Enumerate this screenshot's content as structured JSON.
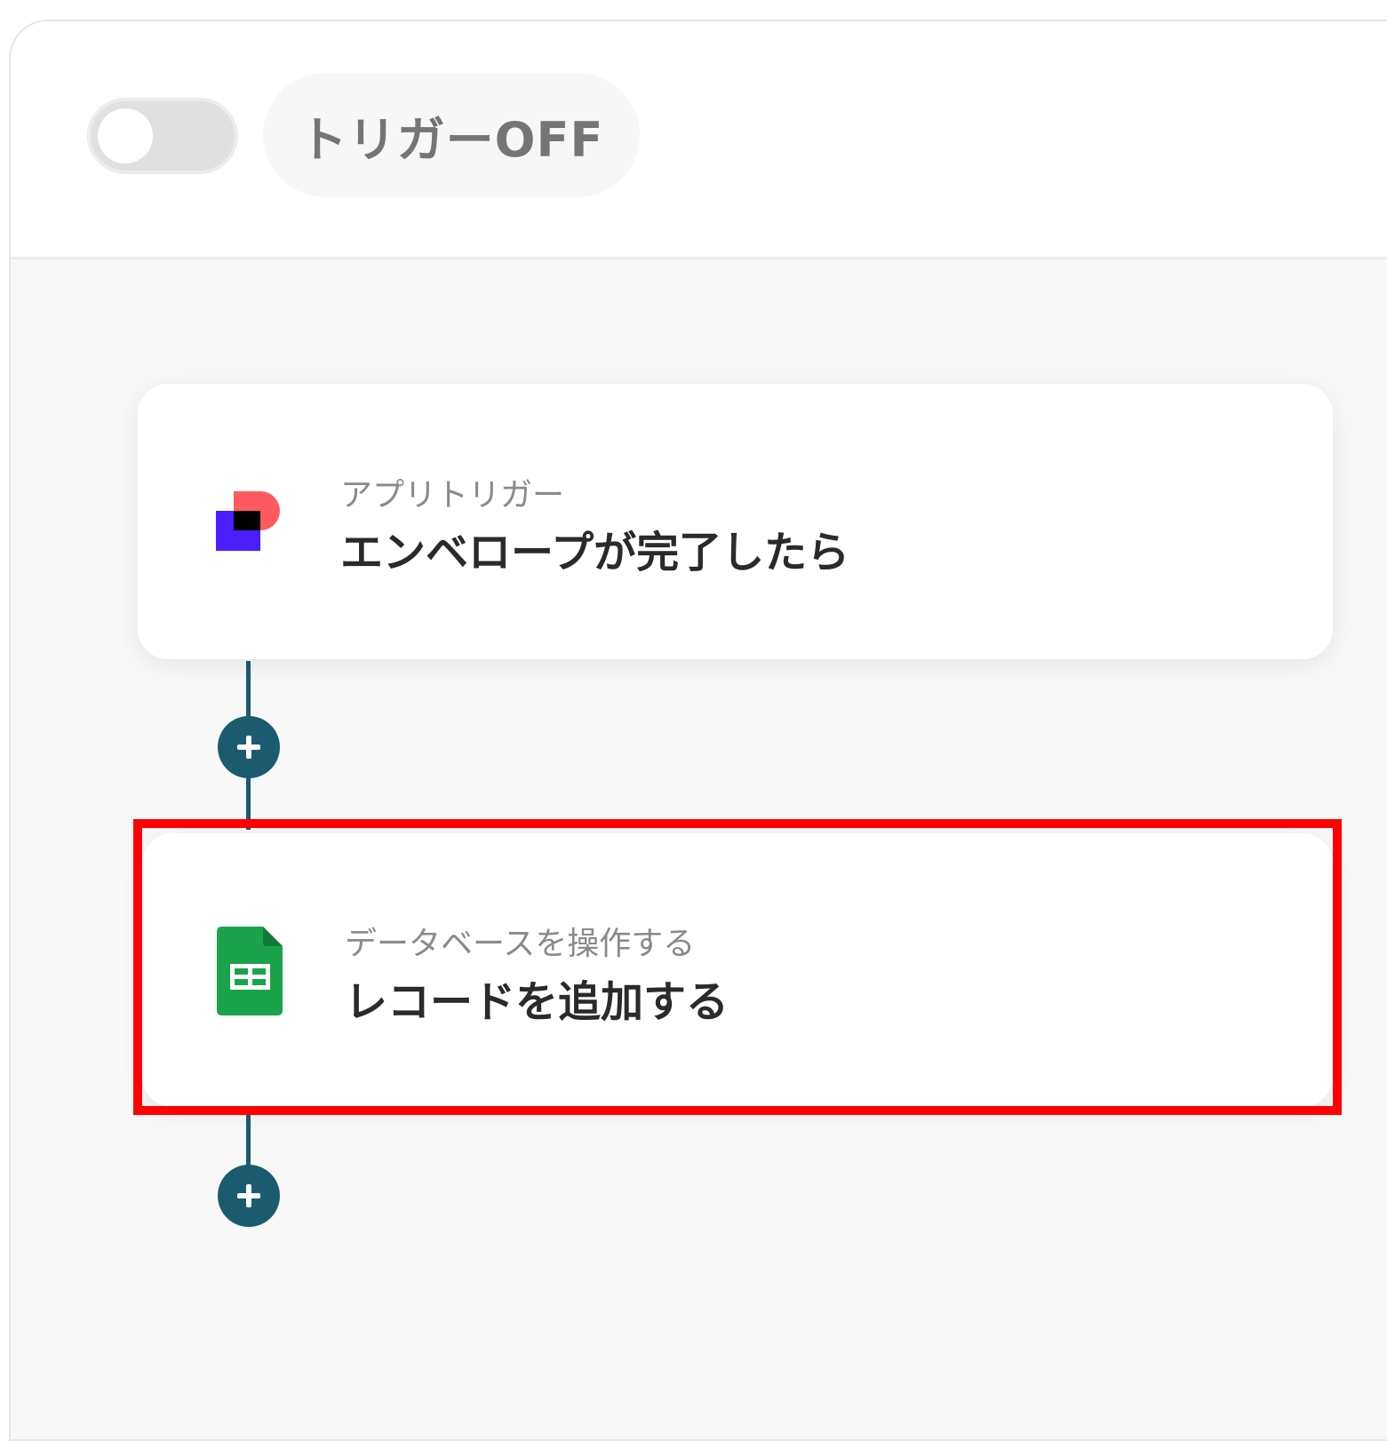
{
  "header": {
    "trigger_toggle": {
      "state": "off",
      "icon": "toggle-switch-icon"
    },
    "status_label": "トリガーOFF"
  },
  "flow": {
    "steps": [
      {
        "label": "アプリトリガー",
        "title": "エンベロープが完了したら",
        "icon": "docusign-app-icon",
        "colors": {
          "square": "#4c1dff",
          "circle": "#ff5a5f",
          "overlap": "#000000"
        }
      },
      {
        "label": "データベースを操作する",
        "title": "レコードを追加する",
        "icon": "google-sheets-icon",
        "colors": {
          "body": "#1aa34a",
          "fold": "#137a36",
          "grid": "#ffffff"
        }
      }
    ],
    "connector_color": "#1c5a6f",
    "add_button_icon": "plus-icon"
  },
  "annotation": {
    "highlight_color": "#ff0000"
  }
}
